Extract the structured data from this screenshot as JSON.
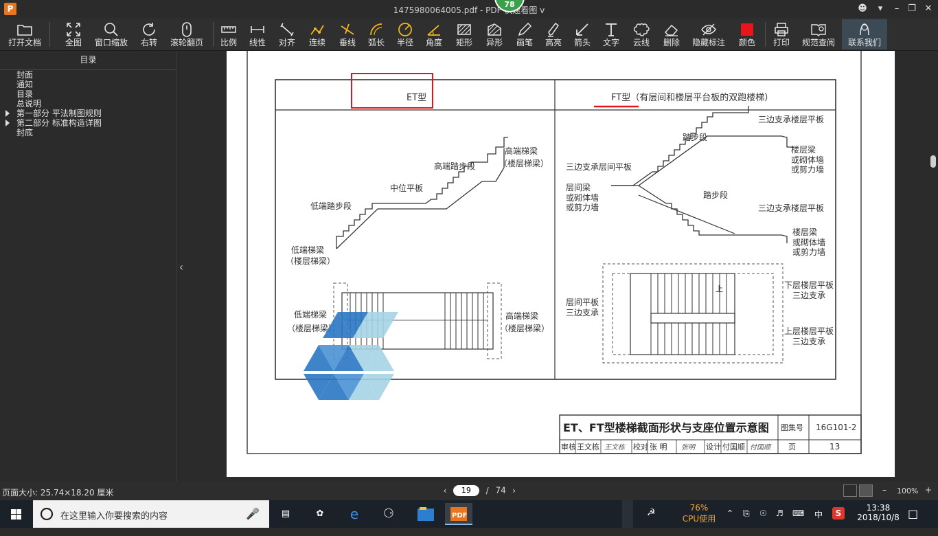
{
  "window": {
    "title": "1475980064005.pdf - PDF 快速看图 v",
    "badge": "78",
    "app_icon": "P"
  },
  "toolbar": {
    "open": "打开文档",
    "fit": "全图",
    "window_zoom": "窗口缩放",
    "rotate": "右转",
    "scroll": "滚轮翻页",
    "scale": "比例",
    "linear": "线性",
    "align": "对齐",
    "continuous": "连续",
    "perpendicular": "垂线",
    "arc_length": "弧长",
    "radius": "半径",
    "angle": "角度",
    "rectangle": "矩形",
    "irregular": "异形",
    "brush": "画笔",
    "highlight": "高亮",
    "arrow": "箭头",
    "text": "文字",
    "cloud": "云线",
    "delete": "删除",
    "hide_marks": "隐藏标注",
    "color": "颜色",
    "print": "打印",
    "spec_query": "规范查阅",
    "contact": "联系我们",
    "color_swatch": "#e8151b"
  },
  "sidebar": {
    "header": "目录",
    "items": [
      {
        "label": "封面",
        "expandable": false
      },
      {
        "label": "通知",
        "expandable": false
      },
      {
        "label": "目录",
        "expandable": false
      },
      {
        "label": "总说明",
        "expandable": false
      },
      {
        "label": "第一部分  平法制图规则",
        "expandable": true
      },
      {
        "label": "第二部分  标准构造详图",
        "expandable": true
      },
      {
        "label": "封底",
        "expandable": false
      }
    ]
  },
  "drawing": {
    "et_header": "ET型",
    "ft_header": "FT型（有层间和楼层平台板的双跑楼梯）",
    "et_labels": {
      "high_beam": "高端梯梁",
      "high_beam_sub": "（楼层梯梁）",
      "high_flight": "高端踏步段",
      "mid_platform": "中位平板",
      "low_flight": "低端踏步段",
      "low_beam": "低端梯梁",
      "low_beam_sub": "（楼层梯梁）",
      "plan_low": "低端梯梁",
      "plan_low_sub": "（楼层梯梁）",
      "plan_high": "高端梯梁",
      "plan_high_sub": "（楼层梯梁）"
    },
    "ft_labels": {
      "three_side_top": "三边支承楼层平板",
      "flight_top": "踏步段",
      "floor_beam_1": "楼层梁",
      "wall_1a": "或砌体墙",
      "wall_1b": "或剪力墙",
      "three_side_landing": "三边支承层间平板",
      "landing_beam": "层间梁",
      "wall_2a": "或砌体墙",
      "wall_2b": "或剪力墙",
      "flight_bottom": "踏步段",
      "three_side_bottom": "三边支承楼层平板",
      "floor_beam_2": "楼层梁",
      "wall_3a": "或砌体墙",
      "wall_3b": "或剪力墙",
      "plan_landing": "层间平板",
      "plan_landing_sub": "三边支承",
      "plan_lower": "下层楼层平板",
      "plan_lower_sub": "三边支承",
      "plan_upper": "上层楼层平板",
      "plan_upper_sub": "三边支承",
      "up_mark": "上"
    },
    "title_block": {
      "title": "ET、FT型楼梯截面形状与支座位置示意图",
      "atlas_label": "图集号",
      "atlas_no": "16G101-2",
      "reviewer_label": "审核",
      "reviewer": "王文栋",
      "reviewer_sig": "王文栋",
      "checker_label": "校对",
      "checker": "张  明",
      "checker_sig": "张明",
      "designer_label": "设计",
      "designer": "付国顺",
      "designer_sig": "付国顺",
      "page_label": "页",
      "page_no": "13"
    },
    "annotation_color": "#e0141b"
  },
  "status": {
    "page_size": "页面大小: 25.74×18.20 厘米",
    "current_page": "19",
    "separator": "/",
    "total_pages": "74",
    "zoom": "100%"
  },
  "taskbar": {
    "search_placeholder": "在这里输入你要搜索的内容",
    "cpu_percent": "76%",
    "cpu_label": "CPU使用",
    "ime": "中",
    "time": "13:38",
    "date": "2018/10/8"
  }
}
